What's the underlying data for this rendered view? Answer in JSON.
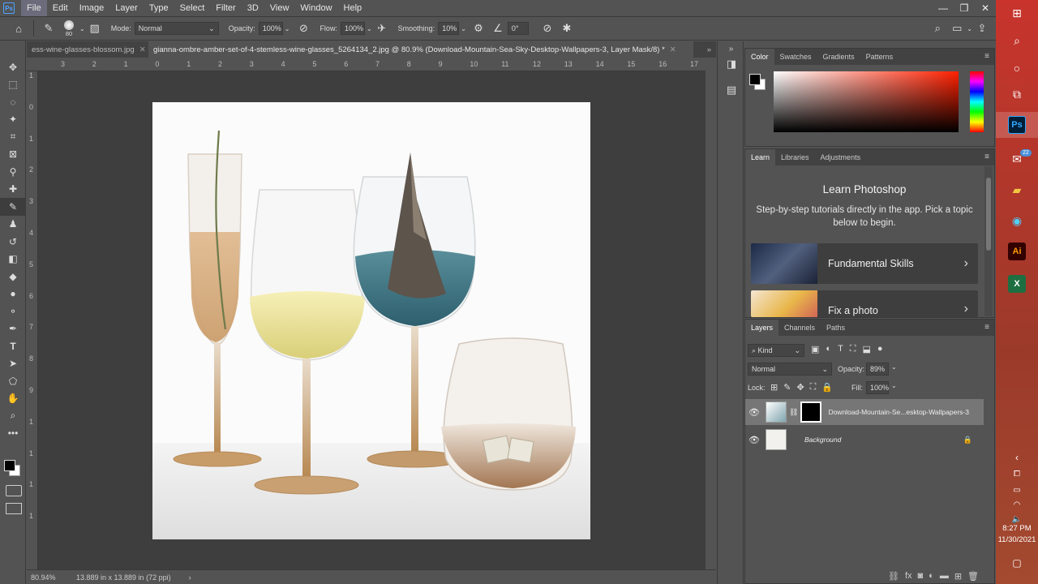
{
  "app": {
    "logo": "Ps",
    "menu": [
      "File",
      "Edit",
      "Image",
      "Layer",
      "Type",
      "Select",
      "Filter",
      "3D",
      "View",
      "Window",
      "Help"
    ]
  },
  "window_controls": {
    "minimize": "—",
    "restore": "❐",
    "close": "✕"
  },
  "options_bar": {
    "brush_size": "80",
    "mode_label": "Mode:",
    "mode_value": "Normal",
    "opacity_label": "Opacity:",
    "opacity_value": "100%",
    "flow_label": "Flow:",
    "flow_value": "100%",
    "smoothing_label": "Smoothing:",
    "smoothing_value": "10%",
    "angle_value": "0°"
  },
  "doc_tabs": [
    {
      "label": "ess-wine-glasses-blossom.jpg",
      "close": "✕",
      "active": false
    },
    {
      "label": "gianna-ombre-amber-set-of-4-stemless-wine-glasses_5264134_2.jpg @ 80.9% (Download-Mountain-Sea-Sky-Desktop-Wallpapers-3, Layer Mask/8) *",
      "close": "✕",
      "active": true
    }
  ],
  "ruler_h_ticks": [
    "3",
    "2",
    "1",
    "0",
    "1",
    "2",
    "3",
    "4",
    "5",
    "6",
    "7",
    "8",
    "9",
    "10",
    "11",
    "12",
    "13",
    "14",
    "15",
    "16",
    "17"
  ],
  "ruler_v_ticks": [
    "1",
    "0",
    "1",
    "2",
    "3",
    "4",
    "5",
    "6",
    "7",
    "8",
    "9",
    "1",
    "1",
    "1",
    "1"
  ],
  "status": {
    "zoom": "80.94%",
    "doc_size": "13.889 in x 13.889 in (72 ppi)",
    "arrow": "›"
  },
  "color_panel": {
    "tabs": [
      "Color",
      "Swatches",
      "Gradients",
      "Patterns"
    ],
    "foreground": "#000000",
    "background": "#ffffff"
  },
  "learn_panel": {
    "tabs": [
      "Learn",
      "Libraries",
      "Adjustments"
    ],
    "title": "Learn Photoshop",
    "description": "Step-by-step tutorials directly in the app. Pick a topic below to begin.",
    "cards": [
      {
        "label": "Fundamental Skills"
      },
      {
        "label": "Fix a photo"
      }
    ]
  },
  "layers_panel": {
    "tabs": [
      "Layers",
      "Channels",
      "Paths"
    ],
    "filter_kind": "Kind",
    "blend_mode": "Normal",
    "opacity_label": "Opacity:",
    "opacity_value": "89%",
    "lock_label": "Lock:",
    "fill_label": "Fill:",
    "fill_value": "100%",
    "layers": [
      {
        "name": "Download-Mountain-Se...esktop-Wallpapers-3",
        "selected": true
      },
      {
        "name": "Background",
        "selected": false
      }
    ]
  },
  "taskbar": {
    "apps": [
      "Ps",
      "Ai",
      "X"
    ],
    "mail_badge": "22",
    "time": "8:27 PM",
    "date": "11/30/2021"
  },
  "colors": {
    "ui_bg": "#535353",
    "ps_blue": "#31a8ff",
    "ai_orange": "#ff9a00",
    "excel_green": "#1d6f42",
    "taskbar_red": "#c8342c"
  }
}
